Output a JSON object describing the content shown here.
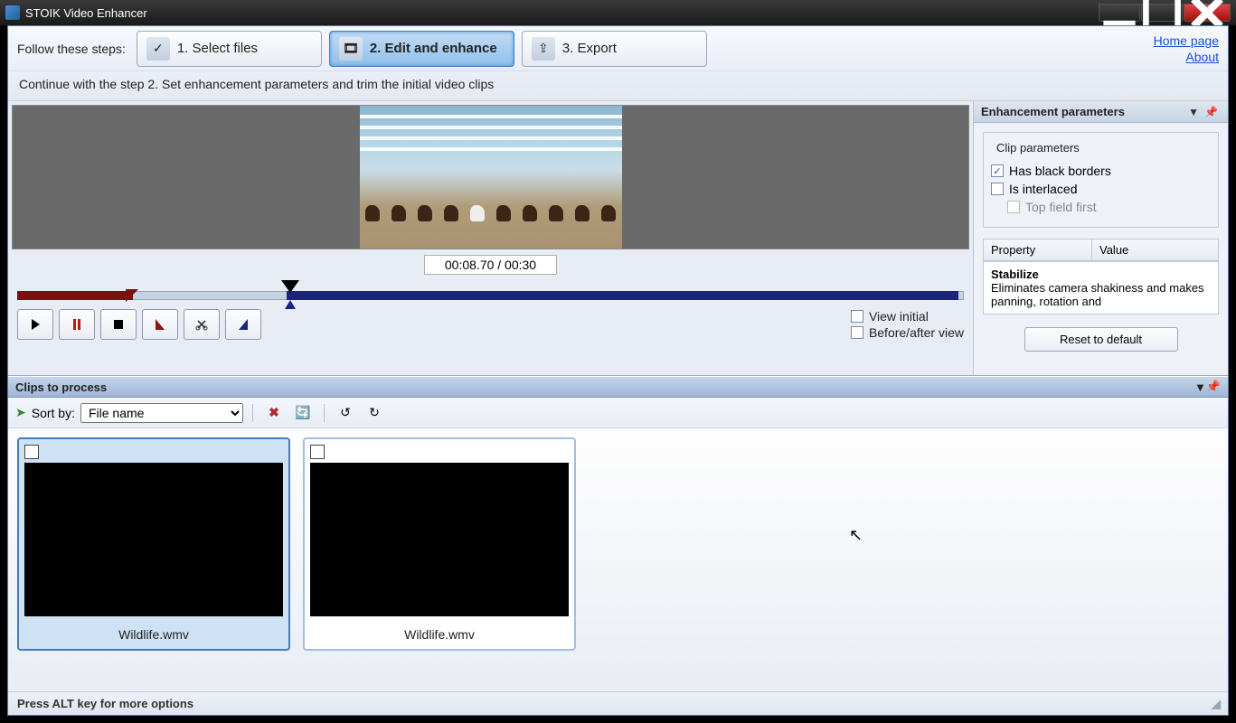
{
  "title": "STOIK Video Enhancer",
  "header": {
    "follow_label": "Follow these steps:",
    "steps": [
      "1. Select files",
      "2. Edit and enhance",
      "3. Export"
    ],
    "links": {
      "home": "Home page",
      "about": "About"
    }
  },
  "instruction": "Continue with the step 2. Set enhancement parameters and trim the initial video clips",
  "preview": {
    "timecode": "00:08.70 / 00:30",
    "view_initial": "View initial",
    "before_after": "Before/after view"
  },
  "params": {
    "panel_title": "Enhancement parameters",
    "clip_group": "Clip parameters",
    "has_black_borders": "Has black borders",
    "is_interlaced": "Is interlaced",
    "top_field_first": "Top field first",
    "col_property": "Property",
    "col_value": "Value",
    "selected_property": "Stabilize",
    "selected_desc": "Eliminates camera shakiness and makes panning, rotation and",
    "reset": "Reset to default"
  },
  "clips": {
    "panel_title": "Clips to process",
    "sort_label": "Sort by:",
    "sort_value": "File name",
    "items": [
      {
        "name": "Wildlife.wmv"
      },
      {
        "name": "Wildlife.wmv"
      }
    ]
  },
  "status": "Press ALT key for more options"
}
